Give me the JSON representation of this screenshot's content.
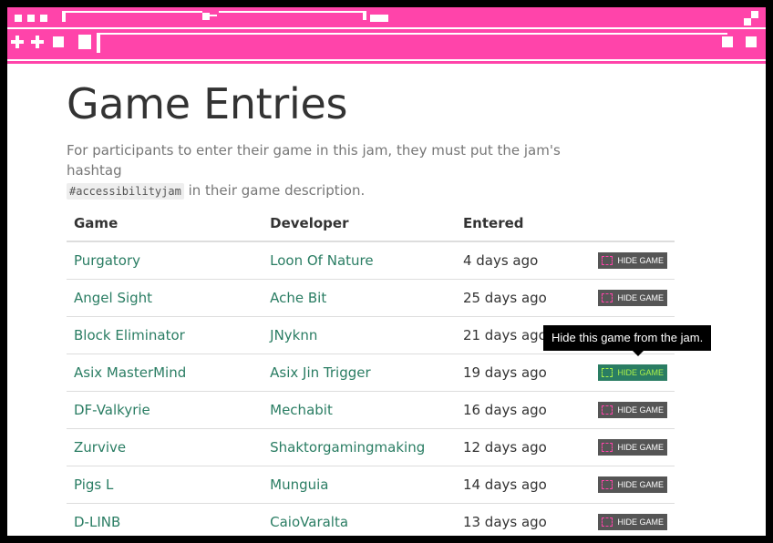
{
  "page_title": "Game Entries",
  "intro": {
    "before": "For participants to enter their game in this jam, they must put the jam's hashtag",
    "hashtag": "#accessibilityjam",
    "after": " in their game description."
  },
  "table": {
    "headers": {
      "game": "Game",
      "developer": "Developer",
      "entered": "Entered"
    },
    "hide_label": "HIDE GAME",
    "rows": [
      {
        "game": "Purgatory",
        "developer": "Loon Of Nature",
        "entered": "4 days ago"
      },
      {
        "game": "Angel Sight",
        "developer": "Ache Bit",
        "entered": "25 days ago"
      },
      {
        "game": "Block Eliminator",
        "developer": "JNyknn",
        "entered": "21 days ago"
      },
      {
        "game": "Asix MasterMind",
        "developer": "Asix Jin Trigger",
        "entered": "19 days ago"
      },
      {
        "game": "DF-Valkyrie",
        "developer": "Mechabit",
        "entered": "16 days ago"
      },
      {
        "game": "Zurvive",
        "developer": "Shaktorgamingmaking",
        "entered": "12 days ago"
      },
      {
        "game": "Pigs L",
        "developer": "Munguia",
        "entered": "14 days ago"
      },
      {
        "game": "D-LINB",
        "developer": "CaioVaralta",
        "entered": "13 days ago"
      }
    ]
  },
  "tooltip": "Hide this game from the jam.",
  "colors": {
    "banner": "#ff44aa",
    "link": "#2a7d63",
    "button": "#555555",
    "button_hover": "#2a7d63",
    "icon_hover": "#aaf04a"
  }
}
